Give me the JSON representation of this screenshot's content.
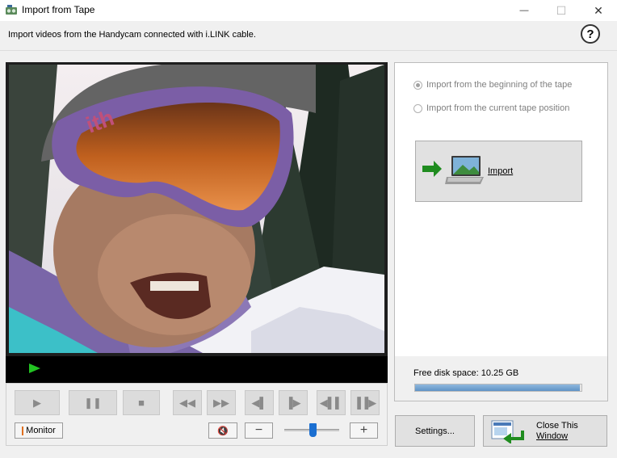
{
  "window": {
    "title": "Import from Tape",
    "minimize_glyph": "—",
    "maximize_glyph": "☐",
    "close_glyph": "✕"
  },
  "header": {
    "instructions": "Import videos from the Handycam connected with i.LINK cable.",
    "help_glyph": "?"
  },
  "player": {
    "status_icon": "play-indicator-icon",
    "transport": [
      {
        "name": "play-button",
        "glyph": "▶"
      },
      {
        "name": "pause-button",
        "glyph": "❚❚"
      },
      {
        "name": "stop-button",
        "glyph": "■"
      },
      {
        "name": "rewind-button",
        "glyph": "◀◀"
      },
      {
        "name": "fast-forward-button",
        "glyph": "▶▶"
      },
      {
        "name": "step-back-button",
        "glyph": "◀▌"
      },
      {
        "name": "step-forward-button",
        "glyph": "▐▶"
      },
      {
        "name": "skip-back-button",
        "glyph": "◀▌▌"
      },
      {
        "name": "skip-forward-button",
        "glyph": "▐▐▶"
      }
    ],
    "monitor_label": "Monitor",
    "mute_glyph": "🔇",
    "volume_minus": "−",
    "volume_plus": "+",
    "volume_level": 0.5
  },
  "import_options": {
    "from_beginning": "Import from the beginning of the tape",
    "from_current": "Import from the current tape position",
    "selected": "from_beginning",
    "import_label": "Import"
  },
  "disk": {
    "label": "Free disk space: 10.25 GB",
    "used_fraction": 0.99
  },
  "buttons": {
    "settings": "Settings...",
    "close_line1": "Close This",
    "close_line2": "Window"
  },
  "colors": {
    "accent_blue": "#1b6fd1",
    "play_green": "#22c322",
    "monitor_orange": "#e07020"
  }
}
